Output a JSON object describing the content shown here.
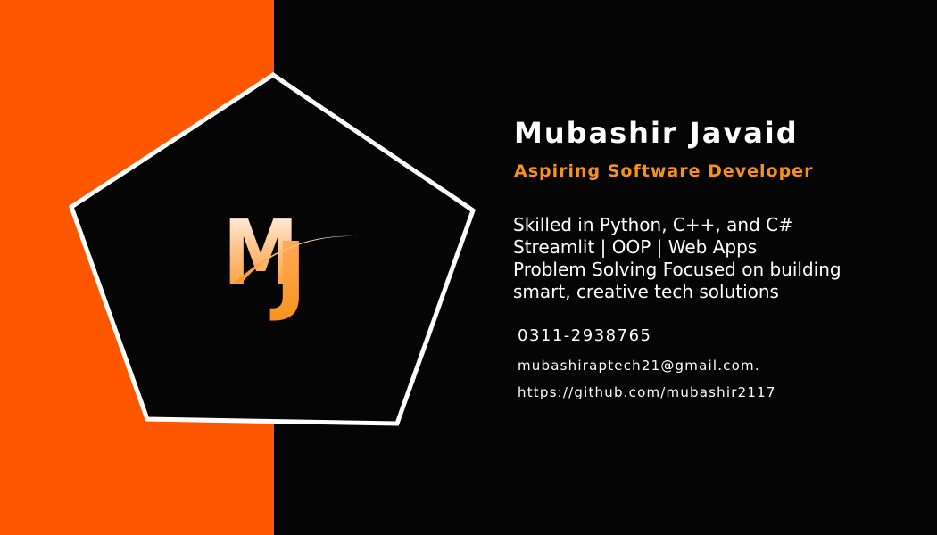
{
  "card": {
    "name": "Mubashir Javaid",
    "role": "Aspiring Software Developer",
    "skills_lines": [
      "Skilled in Python, C++, and C#",
      "Streamlit | OOP | Web Apps",
      "Problem Solving Focused on building",
      "smart, creative tech solutions"
    ],
    "phone": "0311-2938765",
    "email": "mubashiraptech21@gmail.com.",
    "github": "https://github.com/mubashir2117"
  },
  "logo": {
    "letter_m": "M",
    "letter_j": "J",
    "icon": "mj-monogram-logo"
  },
  "colors": {
    "orange_panel": "#ff5700",
    "background": "#050505",
    "accent": "#f7921e",
    "text": "#ffffff",
    "pentagon_stroke": "#ffffff"
  }
}
